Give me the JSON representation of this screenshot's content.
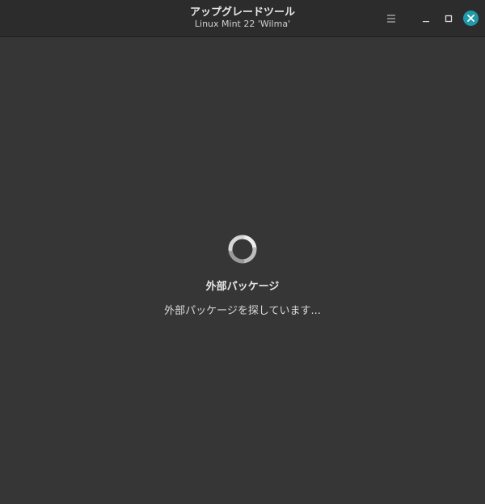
{
  "window": {
    "title": "アップグレードツール",
    "subtitle": "Linux Mint 22 'Wilma'"
  },
  "titlebar_buttons": {
    "menu_icon": "hamburger-menu-icon",
    "minimize_icon": "minimize-icon",
    "maximize_icon": "maximize-icon",
    "close_icon": "close-icon"
  },
  "colors": {
    "background": "#363636",
    "titlebar": "#2c2c2c",
    "close_accent": "#1f9aa8"
  },
  "status": {
    "heading": "外部パッケージ",
    "message": "外部パッケージを探しています..."
  },
  "spinner": {
    "icon": "loading-spinner-icon"
  }
}
